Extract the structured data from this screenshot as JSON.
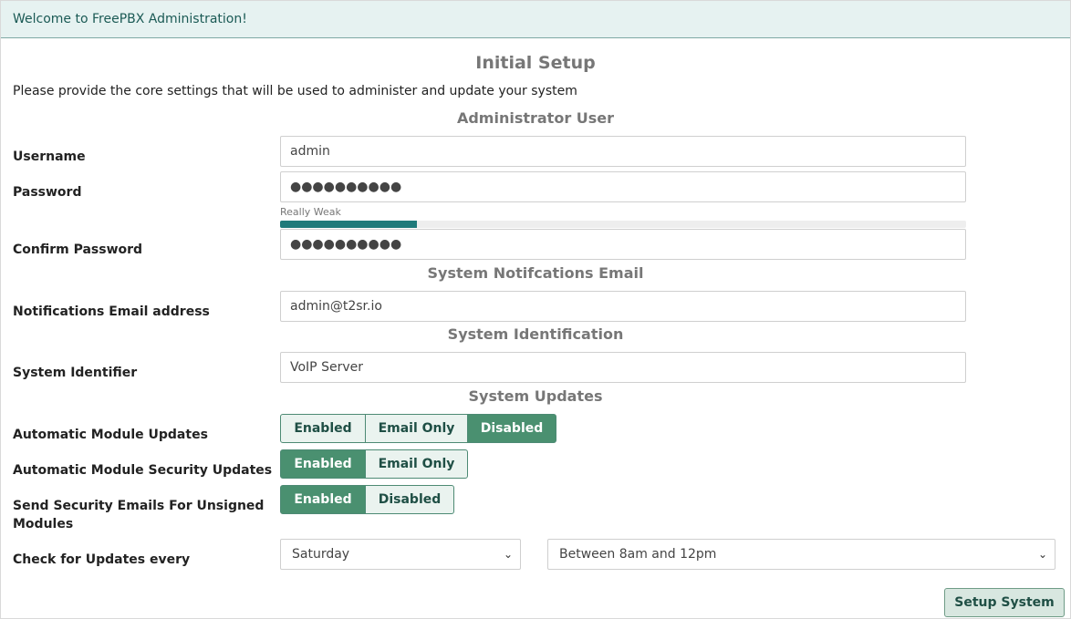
{
  "welcome": "Welcome to FreePBX Administration!",
  "title": "Initial Setup",
  "description": "Please provide the core settings that will be used to administer and update your system",
  "sections": {
    "admin_user": "Administrator User",
    "notifications": "System Notifcations Email",
    "identification": "System Identification",
    "updates": "System Updates"
  },
  "fields": {
    "username": {
      "label": "Username",
      "value": "admin"
    },
    "password": {
      "label": "Password",
      "value": "●●●●●●●●●●"
    },
    "password_strength": {
      "text": "Really Weak",
      "percent": 20
    },
    "confirm_password": {
      "label": "Confirm Password",
      "value": "●●●●●●●●●●"
    },
    "email": {
      "label": "Notifications Email address",
      "value": "admin@t2sr.io"
    },
    "system_identifier": {
      "label": "System Identifier",
      "value": "VoIP Server"
    }
  },
  "updates": {
    "module_updates": {
      "label": "Automatic Module Updates",
      "options": [
        "Enabled",
        "Email Only",
        "Disabled"
      ],
      "selected": "Disabled"
    },
    "security_updates": {
      "label": "Automatic Module Security Updates",
      "options": [
        "Enabled",
        "Email Only"
      ],
      "selected": "Enabled"
    },
    "unsigned_emails": {
      "label_line1": "Send Security Emails For Unsigned",
      "label_line2": "Modules",
      "options": [
        "Enabled",
        "Disabled"
      ],
      "selected": "Enabled"
    },
    "check_every": {
      "label": "Check for Updates every",
      "day": "Saturday",
      "time": "Between 8am and 12pm"
    }
  },
  "submit": "Setup System",
  "colors": {
    "accent": "#4a9070",
    "welcome_bg": "#e6f2f1",
    "strength_fill": "#1f7a7a"
  },
  "icons": {
    "select_chevron": "chevron-down-icon"
  }
}
